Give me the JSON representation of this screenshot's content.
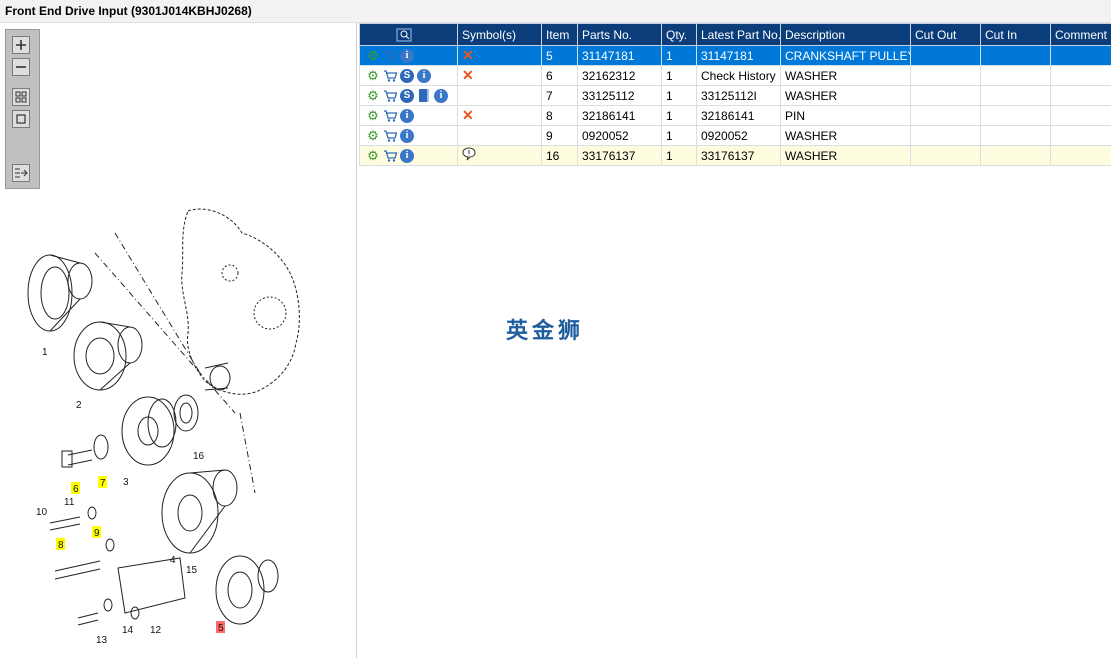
{
  "window": {
    "title": "Front End Drive Input (9301J014KBHJ0268)"
  },
  "toolbar": {
    "zoom_in": "zoom-in-icon",
    "zoom_out": "zoom-out-icon",
    "fit": "fit-icon",
    "actual": "actual-size-icon",
    "export": "export-icon"
  },
  "diagram": {
    "callouts": [
      "1",
      "2",
      "3",
      "4",
      "5",
      "6",
      "7",
      "8",
      "9",
      "10",
      "11",
      "12",
      "13",
      "14",
      "15",
      "16"
    ],
    "highlighted_callouts": [
      "6",
      "7",
      "8",
      "9"
    ],
    "selected_callout": "5"
  },
  "table": {
    "columns": [
      "",
      "Symbol(s)",
      "Item",
      "Parts No.",
      "Qty.",
      "Latest Part No.",
      "Description",
      "Cut Out",
      "Cut In",
      "Comment"
    ],
    "rows": [
      {
        "icons": [
          "gear-icon",
          "cart-icon",
          "info-icon"
        ],
        "symbol": "cross",
        "item": "5",
        "parts_no": "31147181",
        "qty": "1",
        "latest": "31147181",
        "description": "CRANKSHAFT PULLEY",
        "cut_out": "",
        "cut_in": "",
        "comment": "",
        "state": "selected"
      },
      {
        "icons": [
          "gear-icon",
          "cart-icon",
          "s-icon",
          "info-icon"
        ],
        "symbol": "cross",
        "item": "6",
        "parts_no": "32162312",
        "qty": "1",
        "latest": "Check History",
        "description": "WASHER",
        "cut_out": "",
        "cut_in": "",
        "comment": "",
        "state": ""
      },
      {
        "icons": [
          "gear-icon",
          "cart-icon",
          "s-icon",
          "book-icon",
          "info-icon"
        ],
        "symbol": "",
        "item": "7",
        "parts_no": "33125112",
        "qty": "1",
        "latest": "33125112I",
        "description": "WASHER",
        "cut_out": "",
        "cut_in": "",
        "comment": "",
        "state": ""
      },
      {
        "icons": [
          "gear-icon",
          "cart-icon",
          "info-icon"
        ],
        "symbol": "cross",
        "item": "8",
        "parts_no": "32186141",
        "qty": "1",
        "latest": "32186141",
        "description": "PIN",
        "cut_out": "",
        "cut_in": "",
        "comment": "",
        "state": ""
      },
      {
        "icons": [
          "gear-icon",
          "cart-icon",
          "info-icon"
        ],
        "symbol": "",
        "item": "9",
        "parts_no": "0920052",
        "qty": "1",
        "latest": "0920052",
        "description": "WASHER",
        "cut_out": "",
        "cut_in": "",
        "comment": "",
        "state": ""
      },
      {
        "icons": [
          "gear-icon",
          "cart-icon",
          "info-icon"
        ],
        "symbol": "comment",
        "item": "16",
        "parts_no": "33176137",
        "qty": "1",
        "latest": "33176137",
        "description": "WASHER",
        "cut_out": "",
        "cut_in": "",
        "comment": "",
        "state": "highlight"
      }
    ]
  },
  "watermark": "英金狮",
  "colors": {
    "header_bg": "#0b3d7a",
    "selected_row": "#0078d7",
    "highlight_row": "#fefde0",
    "cross": "#e8541e",
    "callout_yellow": "#ffff00",
    "callout_red": "#ff6b6b"
  }
}
